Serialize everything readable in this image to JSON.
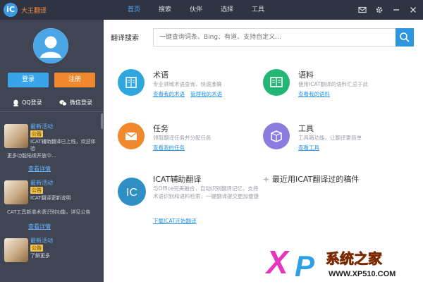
{
  "app": {
    "logo_glyph": "iC",
    "name": "大王翻译"
  },
  "nav": {
    "tabs": [
      "首页",
      "搜索",
      "伙伴",
      "选择",
      "工具"
    ],
    "active_index": 0
  },
  "sidebar": {
    "login_label": "登录",
    "register_label": "注册",
    "qq_login_label": "QQ登录",
    "wechat_login_label": "微信登录",
    "feed": [
      {
        "title": "最新活动",
        "tag": "公告",
        "text": "ICAT辅助翻译已上线，欢迎体验",
        "text2": "更多功能陆续开放中...",
        "link": "查看详情"
      },
      {
        "title": "最新活动",
        "tag": "公告",
        "text": "ICAT翻译更新说明",
        "text2": "CAT工具新增术语识别功能，详见公告",
        "link": "查看详情"
      },
      {
        "title": "最新活动",
        "tag": "公告",
        "text": "了解更多",
        "text2": "",
        "link": ""
      }
    ]
  },
  "main": {
    "search_label": "翻译搜索",
    "search_placeholder": "一键查询词条、Bing、有道、支持自定义...",
    "cards": [
      {
        "title": "术语",
        "desc": "专业领域术语查询，快速准确",
        "links": [
          "查看我的术语",
          "管理我的术语"
        ],
        "color": "#2fa7de"
      },
      {
        "title": "语料",
        "desc": "使用ICAT翻译的语料汇总于此",
        "links": [
          "查看我的语料"
        ],
        "color": "#22b573"
      },
      {
        "title": "任务",
        "desc": "领取翻译任务并分配任务",
        "links": [
          "查看我的任务"
        ],
        "color": "#f0892d"
      },
      {
        "title": "工具",
        "desc": "工具箱功能，让翻译更简单",
        "links": [
          "查看工具"
        ],
        "color": "#8c7be0"
      },
      {
        "title": "ICAT辅助翻译",
        "desc": "与Office完美融合，自动识别翻译记忆，支持术语识别和语料检索，一键翻译提交更加便捷",
        "links": [
          "下载ICAT开始翻译"
        ],
        "color": "#2d8fc4"
      }
    ],
    "recent_label": "最近用ICAT翻译过的稿件"
  },
  "watermark": {
    "brand": "XP系统之家",
    "url": "WWW.XP510.COM"
  }
}
